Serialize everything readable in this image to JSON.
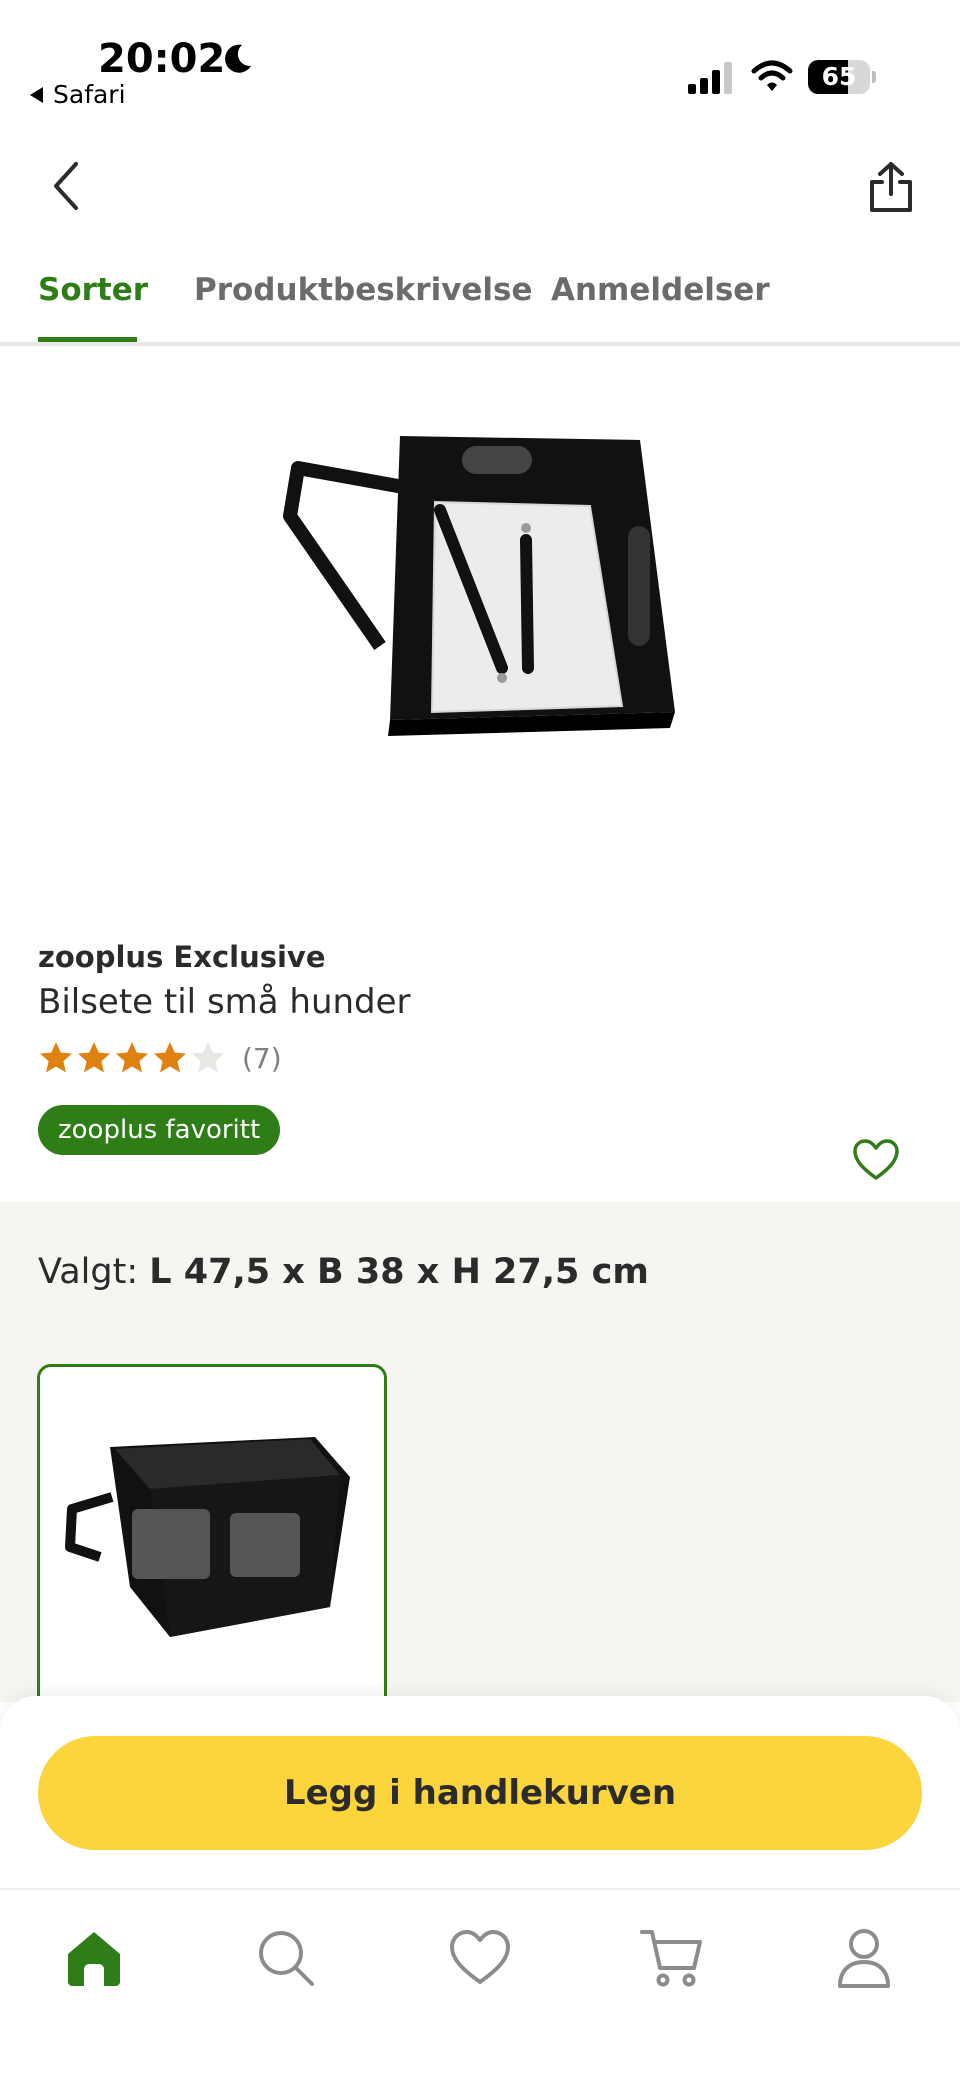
{
  "status_bar": {
    "time": "20:02",
    "back_app": "Safari",
    "battery_level": 65,
    "battery_text": "65",
    "icons": [
      "moon-icon",
      "signal-icon",
      "wifi-icon",
      "battery-icon"
    ]
  },
  "nav": {
    "icons": [
      "chevron-left-icon",
      "share-icon"
    ]
  },
  "tabs": [
    {
      "label": "Sorter",
      "active": true
    },
    {
      "label": "Produktbeskrivelse",
      "active": false
    },
    {
      "label": "Anmeldelser",
      "active": false
    }
  ],
  "gallery": {
    "image_count": 10,
    "active_index": 6,
    "favorite_icon": "heart-outline-icon"
  },
  "product": {
    "brand": "zooplus Exclusive",
    "name": "Bilsete til små hunder",
    "rating": 4,
    "rating_max": 5,
    "review_count": "(7)",
    "badge": "zooplus favoritt"
  },
  "variant": {
    "selected_prefix": "Valgt: ",
    "selected_value": "L 47,5 x B 38 x H 27,5 cm"
  },
  "cta": {
    "label": "Legg i handlekurven"
  },
  "tabbar": {
    "items": [
      "home-icon",
      "search-icon",
      "heart-icon",
      "cart-icon",
      "profile-icon"
    ],
    "active": "home-icon"
  },
  "colors": {
    "brand_green": "#2f7d16",
    "cta_yellow": "#fcd43b",
    "star_orange": "#e0820f",
    "star_empty": "#e9e7e3"
  }
}
